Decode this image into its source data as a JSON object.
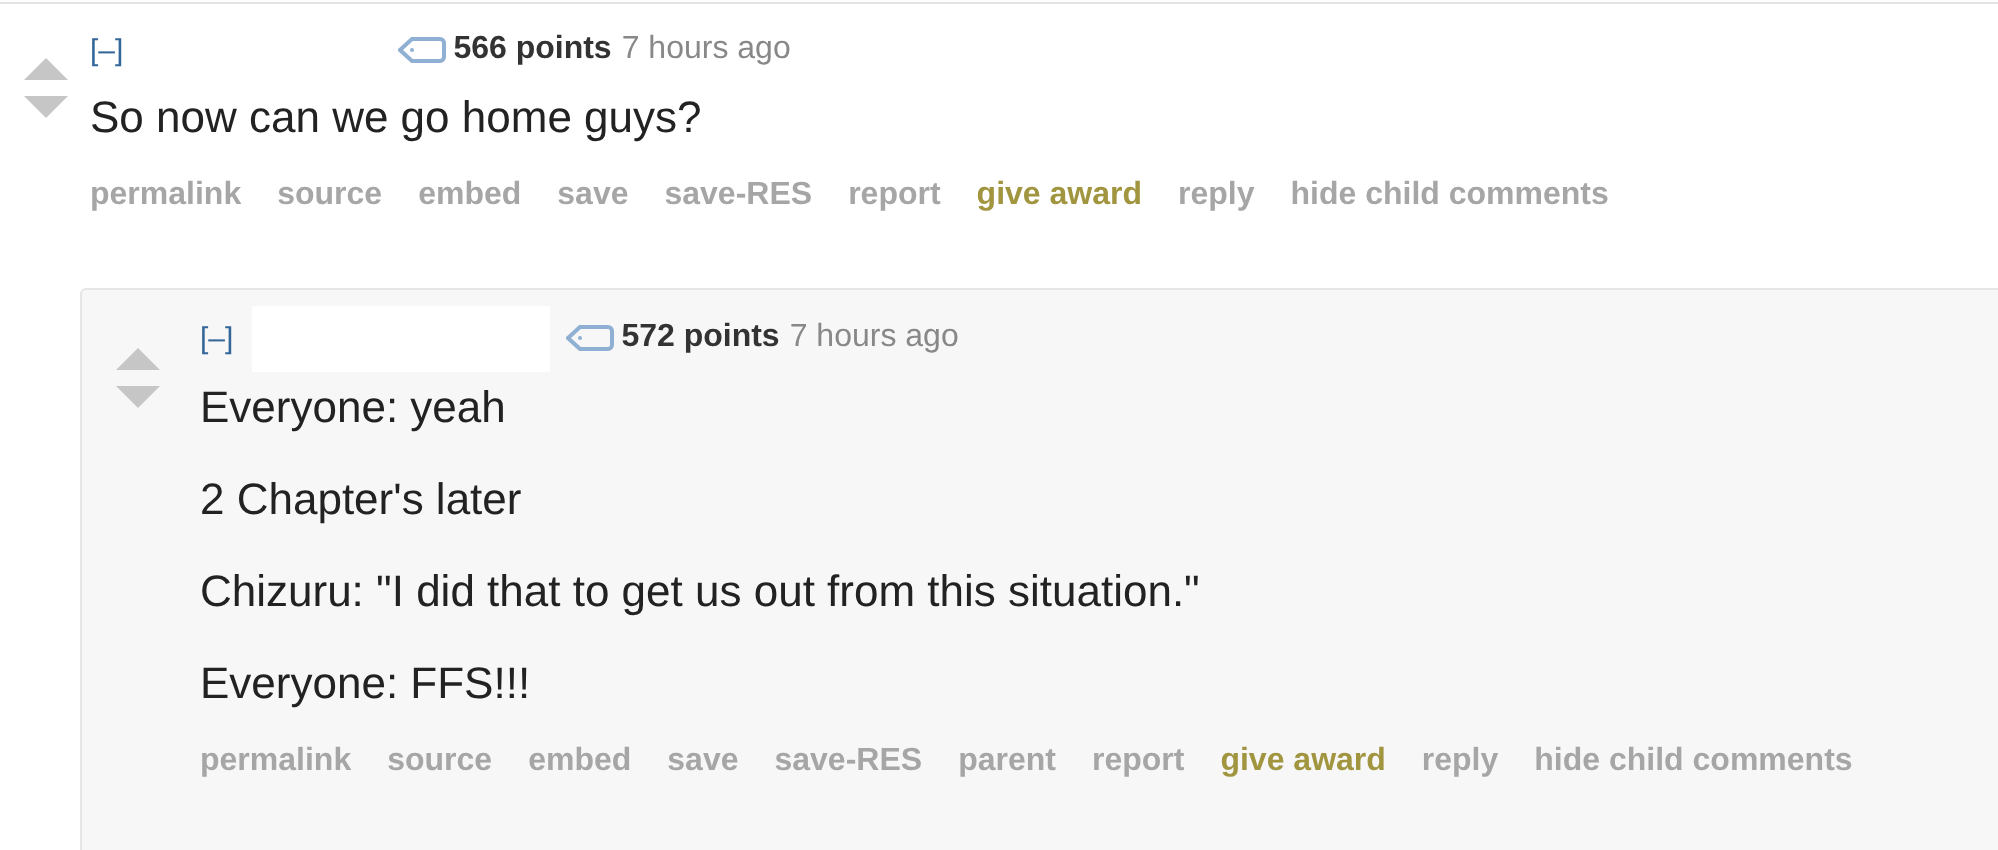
{
  "comments": [
    {
      "collapse": "[–]",
      "points": "566 points",
      "time": "7 hours ago",
      "body": [
        "So now can we go home guys?"
      ],
      "actions": [
        {
          "label": "permalink",
          "kind": "link"
        },
        {
          "label": "source",
          "kind": "link"
        },
        {
          "label": "embed",
          "kind": "link"
        },
        {
          "label": "save",
          "kind": "link"
        },
        {
          "label": "save-RES",
          "kind": "link"
        },
        {
          "label": "report",
          "kind": "link"
        },
        {
          "label": "give award",
          "kind": "award"
        },
        {
          "label": "reply",
          "kind": "link"
        },
        {
          "label": "hide child comments",
          "kind": "link"
        }
      ],
      "children": [
        {
          "collapse": "[–]",
          "redacted_author": true,
          "points": "572 points",
          "time": "7 hours ago",
          "body": [
            "Everyone: yeah",
            "2 Chapter's later",
            "Chizuru: \"I did that to get us out from this situation.\"",
            "Everyone: FFS!!!"
          ],
          "actions": [
            {
              "label": "permalink",
              "kind": "link"
            },
            {
              "label": "source",
              "kind": "link"
            },
            {
              "label": "embed",
              "kind": "link"
            },
            {
              "label": "save",
              "kind": "link"
            },
            {
              "label": "save-RES",
              "kind": "link"
            },
            {
              "label": "parent",
              "kind": "link"
            },
            {
              "label": "report",
              "kind": "link"
            },
            {
              "label": "give award",
              "kind": "award"
            },
            {
              "label": "reply",
              "kind": "link"
            },
            {
              "label": "hide child comments",
              "kind": "link"
            }
          ]
        }
      ]
    }
  ]
}
